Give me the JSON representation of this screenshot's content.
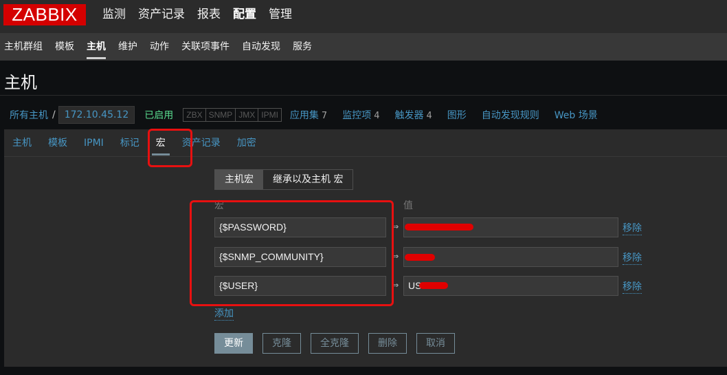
{
  "logo": "ZABBIX",
  "main_menu": [
    "监测",
    "资产记录",
    "报表",
    "配置",
    "管理"
  ],
  "sub_menu": [
    "主机群组",
    "模板",
    "主机",
    "维护",
    "动作",
    "关联项事件",
    "自动发现",
    "服务"
  ],
  "page_title": "主机",
  "breadcrumb": {
    "all_hosts": "所有主机",
    "separator": "/",
    "host": "172.10.45.12",
    "status": "已启用",
    "interfaces": [
      "ZBX",
      "SNMP",
      "JMX",
      "IPMI"
    ],
    "links": [
      {
        "label": "应用集",
        "count": "7"
      },
      {
        "label": "监控项",
        "count": "4"
      },
      {
        "label": "触发器",
        "count": "4"
      },
      {
        "label": "图形",
        "count": ""
      },
      {
        "label": "自动发现规则",
        "count": ""
      },
      {
        "label": "Web 场景",
        "count": ""
      }
    ]
  },
  "tabs": [
    "主机",
    "模板",
    "IPMI",
    "标记",
    "宏",
    "资产记录",
    "加密"
  ],
  "macro_view": {
    "host_macros": "主机宏",
    "inherited": "继承以及主机 宏"
  },
  "columns": {
    "macro": "宏",
    "value": "值"
  },
  "macros": [
    {
      "name": "{$PASSWORD}",
      "value": "",
      "remove": "移除"
    },
    {
      "name": "{$SNMP_COMMUNITY}",
      "value": "",
      "remove": "移除"
    },
    {
      "name": "{$USER}",
      "value": "US",
      "remove": "移除"
    }
  ],
  "arrow": "⇒",
  "add": "添加",
  "buttons": {
    "update": "更新",
    "clone": "克隆",
    "full_clone": "全克隆",
    "delete": "删除",
    "cancel": "取消"
  },
  "colors": {
    "brand": "#d40000",
    "link": "#4796c4",
    "enabled": "#59db8f",
    "annotation": "#e81010"
  }
}
